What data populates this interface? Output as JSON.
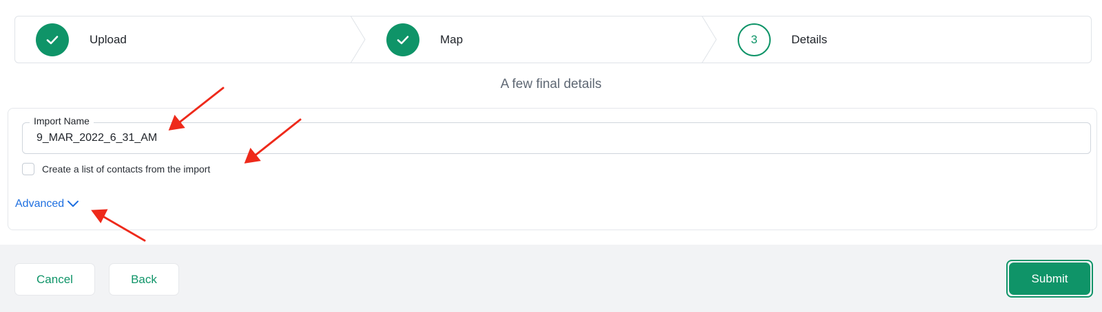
{
  "stepper": {
    "steps": [
      {
        "label": "Upload",
        "state": "done"
      },
      {
        "label": "Map",
        "state": "done"
      },
      {
        "label": "Details",
        "state": "current",
        "number": "3"
      }
    ]
  },
  "page": {
    "subtitle": "A few final details"
  },
  "form": {
    "import_name_label": "Import Name",
    "import_name_value": "9_MAR_2022_6_31_AM",
    "create_list_label": "Create a list of contacts from the import",
    "create_list_checked": false,
    "advanced_label": "Advanced"
  },
  "footer": {
    "cancel_label": "Cancel",
    "back_label": "Back",
    "submit_label": "Submit"
  },
  "colors": {
    "accent": "#0f9468",
    "link": "#1e6fe0",
    "annotation": "#ee2a1b"
  }
}
